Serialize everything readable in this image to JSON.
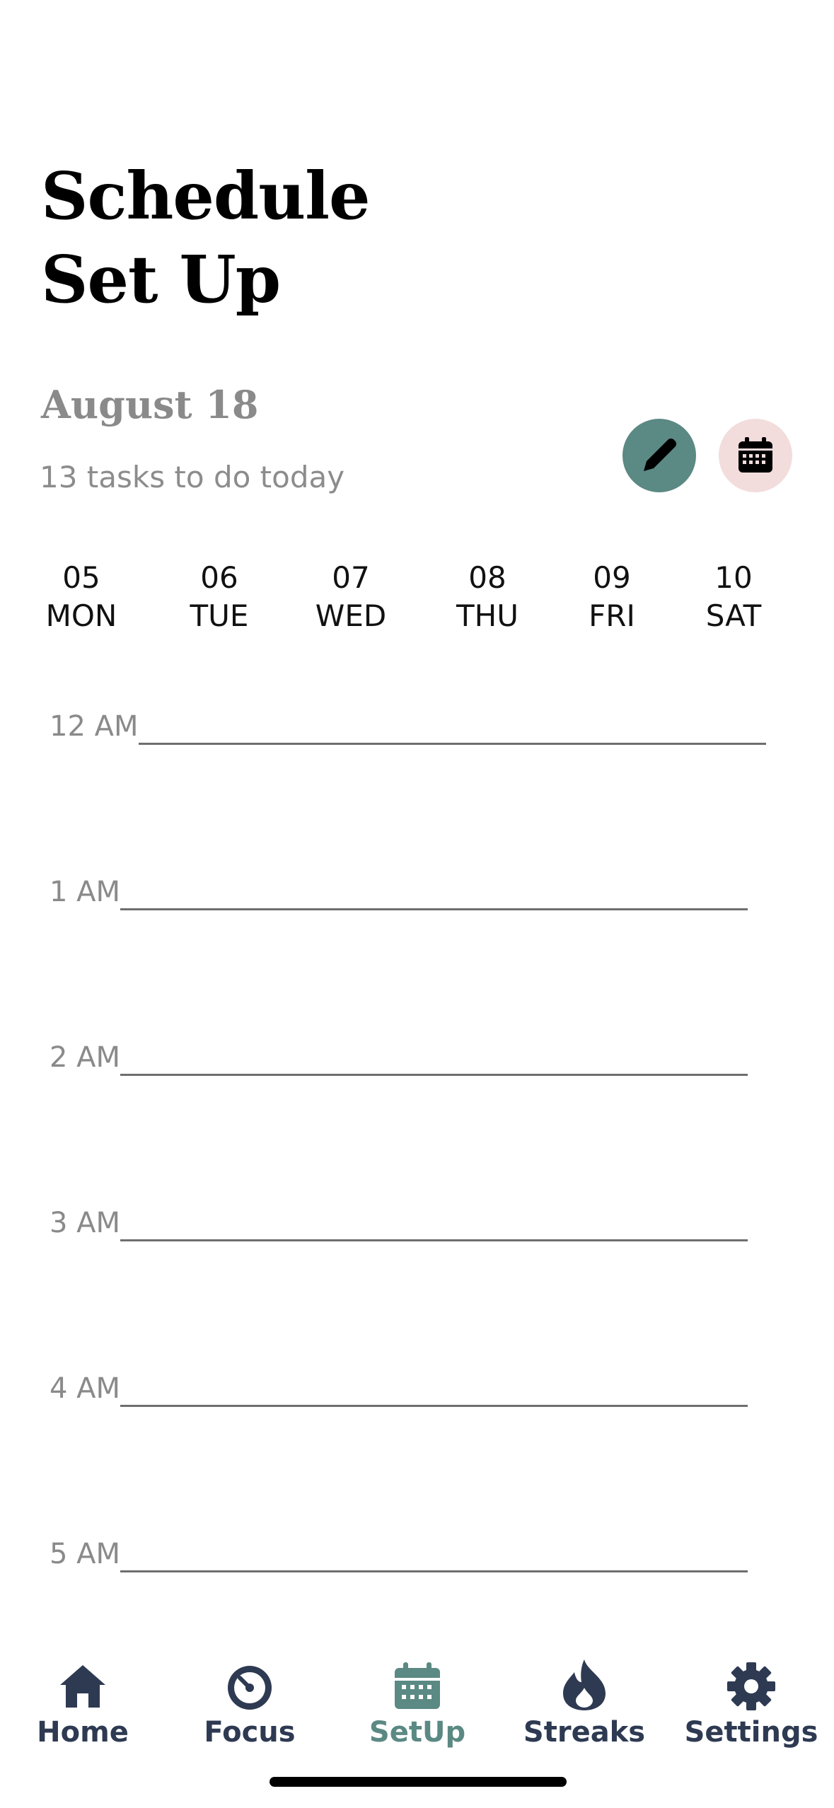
{
  "header": {
    "title_line1": "Schedule",
    "title_line2": "Set Up",
    "date": "August 18",
    "task_count": "13 tasks to do today"
  },
  "actions": {
    "edit_icon": "pencil-icon",
    "calendar_icon": "calendar-icon",
    "edit_color": "#5b8983",
    "calendar_color": "#f3dcdc"
  },
  "days": [
    {
      "num": "05",
      "name": "MON"
    },
    {
      "num": "06",
      "name": "TUE"
    },
    {
      "num": "07",
      "name": "WED"
    },
    {
      "num": "08",
      "name": "THU"
    },
    {
      "num": "09",
      "name": "FRI"
    },
    {
      "num": "10",
      "name": "SAT"
    }
  ],
  "hours": [
    "12 AM",
    "1 AM",
    "2 AM",
    "3 AM",
    "4 AM",
    "5 AM"
  ],
  "tabs": [
    {
      "label": "Home",
      "icon": "home-icon"
    },
    {
      "label": "Focus",
      "icon": "timer-icon"
    },
    {
      "label": "SetUp",
      "icon": "calendar-icon"
    },
    {
      "label": "Streaks",
      "icon": "flame-icon"
    },
    {
      "label": "Settings",
      "icon": "gear-icon"
    }
  ],
  "colors": {
    "accent": "#5b8983",
    "tab_inactive": "#2e3a52"
  }
}
